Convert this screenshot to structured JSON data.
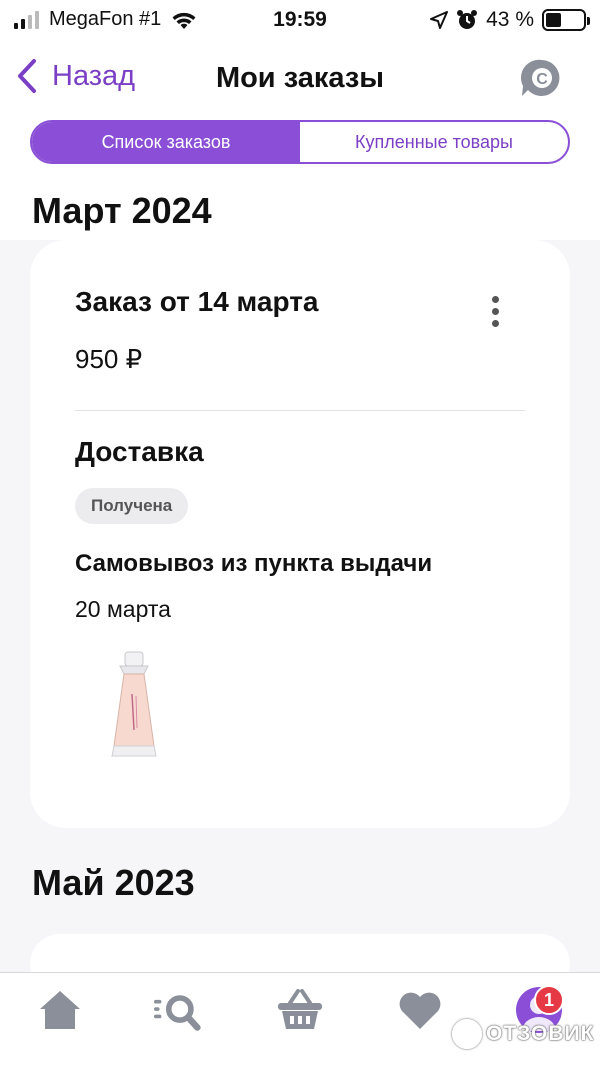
{
  "status_bar": {
    "carrier": "MegaFon #1",
    "time": "19:59",
    "battery": "43 %",
    "battery_level": 0.43
  },
  "header": {
    "back_label": "Назад",
    "title": "Мои заказы"
  },
  "segments": {
    "orders_list": "Список заказов",
    "purchased_items": "Купленные товары",
    "active": "orders_list"
  },
  "sections": [
    {
      "month": "Март 2024",
      "order": {
        "title": "Заказ от 14 марта",
        "price": "950 ₽",
        "delivery_heading": "Доставка",
        "status": "Получена",
        "method": "Самовывоз из пункта выдачи",
        "date": "20 марта",
        "product_image": "perfume-bottle"
      }
    },
    {
      "month": "Май 2023"
    }
  ],
  "tab_bar": {
    "items": [
      "home-icon",
      "search-icon",
      "basket-icon",
      "heart-icon",
      "profile-avatar"
    ],
    "notification_count": "1"
  },
  "watermark": "ОТЗОВИК",
  "colors": {
    "accent": "#8a4fd6",
    "accent_text": "#7b3fc5",
    "badge_bg": "#ececef",
    "notification": "#e53946"
  }
}
